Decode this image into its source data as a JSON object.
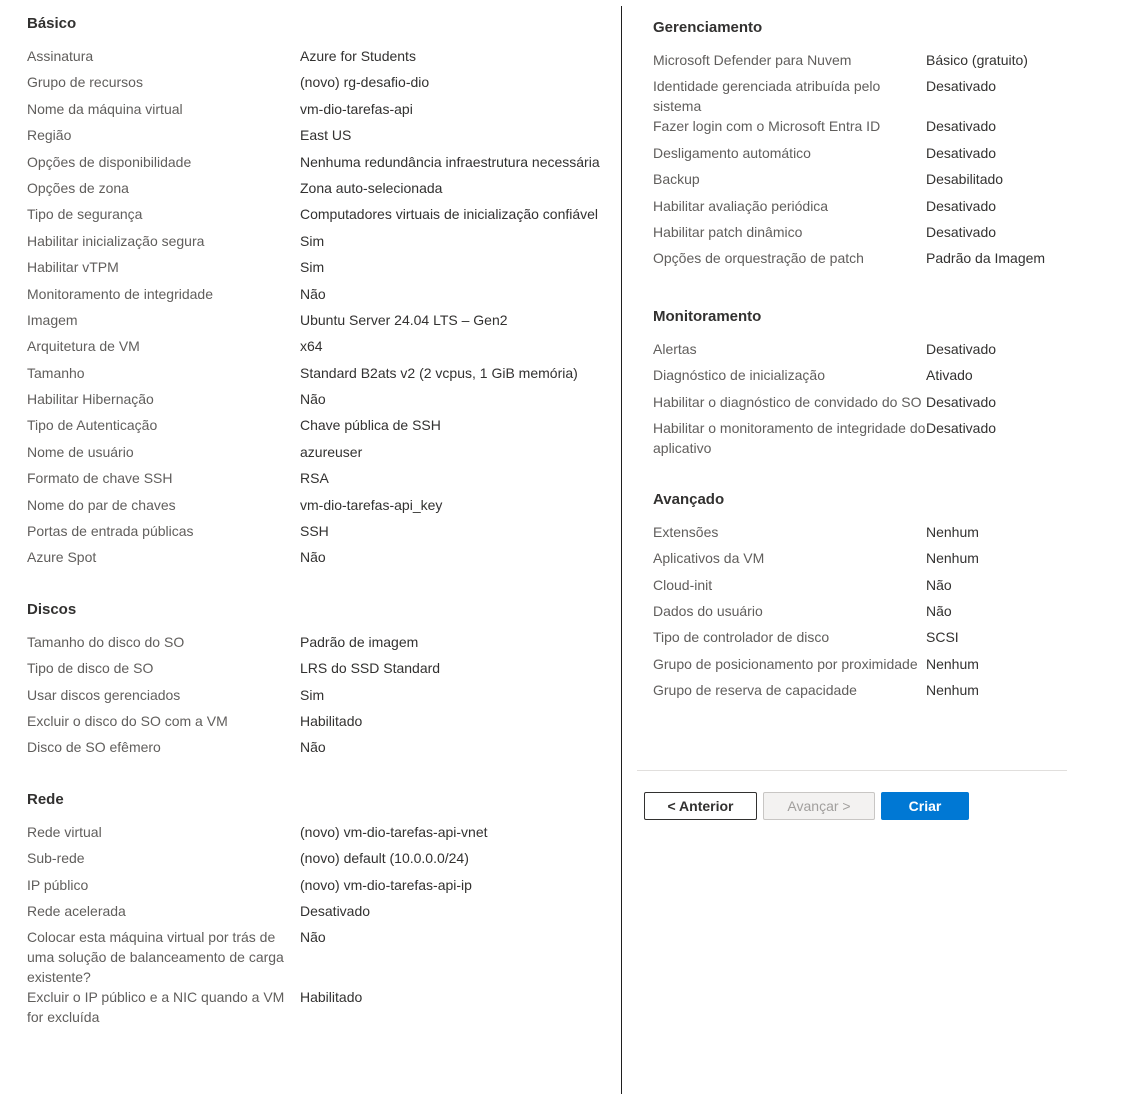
{
  "basico": {
    "title": "Básico",
    "rows": [
      {
        "label": "Assinatura",
        "value": "Azure for Students"
      },
      {
        "label": "Grupo de recursos",
        "value": "(novo) rg-desafio-dio"
      },
      {
        "label": "Nome da máquina virtual",
        "value": "vm-dio-tarefas-api"
      },
      {
        "label": "Região",
        "value": "East US"
      },
      {
        "label": "Opções de disponibilidade",
        "value": "Nenhuma redundância infraestrutura necessária"
      },
      {
        "label": "Opções de zona",
        "value": "Zona auto-selecionada"
      },
      {
        "label": "Tipo de segurança",
        "value": "Computadores virtuais de inicialização confiável"
      },
      {
        "label": "Habilitar inicialização segura",
        "value": "Sim"
      },
      {
        "label": "Habilitar vTPM",
        "value": "Sim"
      },
      {
        "label": "Monitoramento de integridade",
        "value": "Não"
      },
      {
        "label": "Imagem",
        "value": "Ubuntu Server 24.04 LTS – Gen2"
      },
      {
        "label": "Arquitetura de VM",
        "value": "x64"
      },
      {
        "label": "Tamanho",
        "value": "Standard B2ats v2 (2 vcpus, 1 GiB memória)"
      },
      {
        "label": "Habilitar Hibernação",
        "value": "Não"
      },
      {
        "label": "Tipo de Autenticação",
        "value": "Chave pública de SSH"
      },
      {
        "label": "Nome de usuário",
        "value": "azureuser"
      },
      {
        "label": "Formato de chave SSH",
        "value": "RSA"
      },
      {
        "label": "Nome do par de chaves",
        "value": "vm-dio-tarefas-api_key"
      },
      {
        "label": "Portas de entrada públicas",
        "value": "SSH"
      },
      {
        "label": "Azure Spot",
        "value": "Não"
      }
    ]
  },
  "discos": {
    "title": "Discos",
    "rows": [
      {
        "label": "Tamanho do disco do SO",
        "value": "Padrão de imagem"
      },
      {
        "label": "Tipo de disco de SO",
        "value": "LRS do SSD Standard"
      },
      {
        "label": "Usar discos gerenciados",
        "value": "Sim"
      },
      {
        "label": "Excluir o disco do SO com a VM",
        "value": "Habilitado"
      },
      {
        "label": "Disco de SO efêmero",
        "value": "Não"
      }
    ]
  },
  "rede": {
    "title": "Rede",
    "rows": [
      {
        "label": "Rede virtual",
        "value": "(novo) vm-dio-tarefas-api-vnet"
      },
      {
        "label": "Sub-rede",
        "value": "(novo) default (10.0.0.0/24)"
      },
      {
        "label": "IP público",
        "value": "(novo) vm-dio-tarefas-api-ip"
      },
      {
        "label": "Rede acelerada",
        "value": "Desativado"
      },
      {
        "label": "Colocar esta máquina virtual por trás de uma solução de balanceamento de carga existente?",
        "value": "Não"
      },
      {
        "label": "Excluir o IP público e a NIC quando a VM for excluída",
        "value": "Habilitado"
      }
    ]
  },
  "gerenciamento": {
    "title": "Gerenciamento",
    "rows": [
      {
        "label": "Microsoft Defender para Nuvem",
        "value": "Básico (gratuito)"
      },
      {
        "label": "Identidade gerenciada atribuída pelo sistema",
        "value": "Desativado"
      },
      {
        "label": "Fazer login com o Microsoft Entra ID",
        "value": "Desativado"
      },
      {
        "label": "Desligamento automático",
        "value": "Desativado"
      },
      {
        "label": "Backup",
        "value": "Desabilitado"
      },
      {
        "label": "Habilitar avaliação periódica",
        "value": "Desativado"
      },
      {
        "label": "Habilitar patch dinâmico",
        "value": "Desativado"
      },
      {
        "label": "Opções de orquestração de patch",
        "value": "Padrão da Imagem"
      }
    ]
  },
  "monitoramento": {
    "title": "Monitoramento",
    "rows": [
      {
        "label": "Alertas",
        "value": "Desativado"
      },
      {
        "label": "Diagnóstico de inicialização",
        "value": "Ativado"
      },
      {
        "label": "Habilitar o diagnóstico de convidado do SO",
        "value": "Desativado"
      },
      {
        "label": "Habilitar o monitoramento de integridade do aplicativo",
        "value": "Desativado"
      }
    ]
  },
  "avancado": {
    "title": "Avançado",
    "rows": [
      {
        "label": "Extensões",
        "value": "Nenhum"
      },
      {
        "label": "Aplicativos da VM",
        "value": "Nenhum"
      },
      {
        "label": "Cloud-init",
        "value": "Não"
      },
      {
        "label": "Dados do usuário",
        "value": "Não"
      },
      {
        "label": "Tipo de controlador de disco",
        "value": "SCSI"
      },
      {
        "label": "Grupo de posicionamento por proximidade",
        "value": "Nenhum"
      },
      {
        "label": "Grupo de reserva de capacidade",
        "value": "Nenhum"
      }
    ]
  },
  "actions": {
    "previous_label": "< Anterior",
    "next_label": "Avançar >",
    "create_label": "Criar"
  },
  "colors": {
    "primary": "#0078d4",
    "label_text": "#605e5c",
    "value_text": "#323130"
  }
}
